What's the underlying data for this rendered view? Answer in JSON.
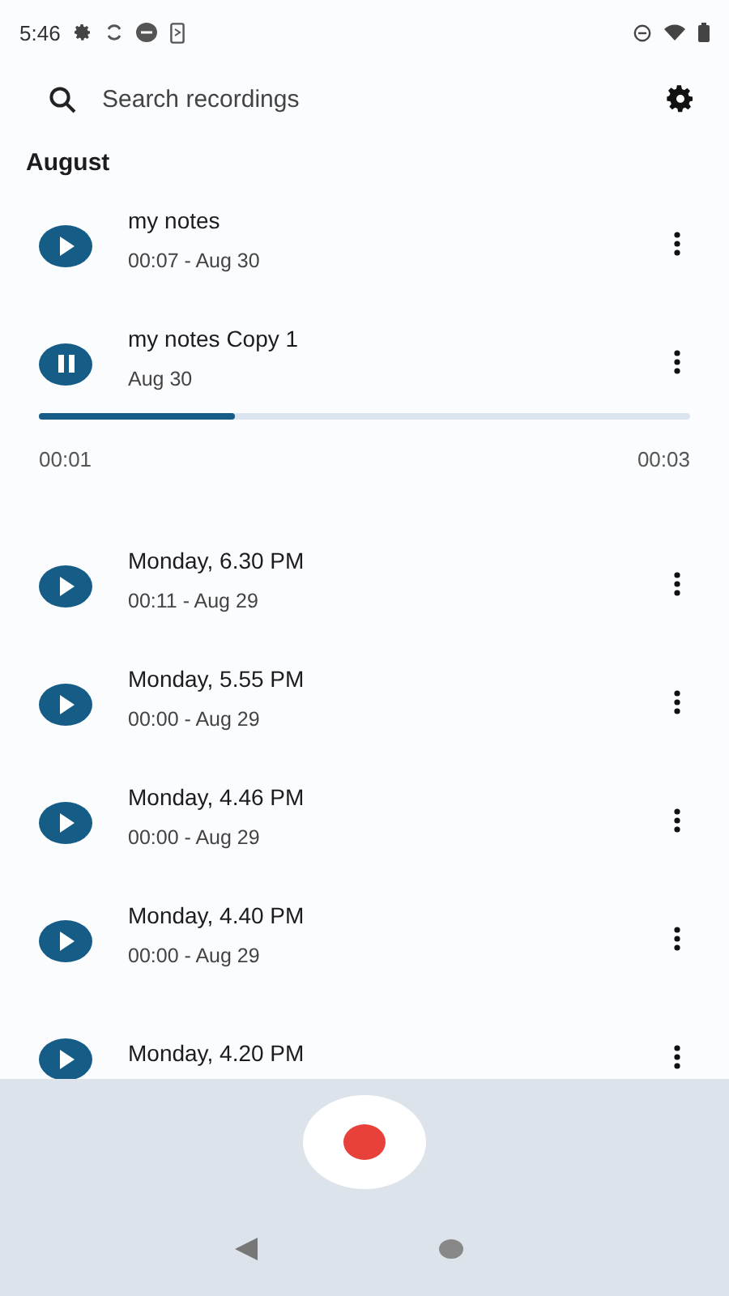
{
  "status_bar": {
    "time": "5:46"
  },
  "search": {
    "placeholder": "Search recordings"
  },
  "section": "August",
  "recordings": [
    {
      "title": "my notes",
      "subtitle": "00:07 - Aug 30",
      "playing": false
    },
    {
      "title": "my notes Copy 1",
      "subtitle": "Aug 30",
      "playing": true,
      "level": 0.3,
      "elapsed": "00:01",
      "total": "00:03"
    },
    {
      "title": "Monday, 6.30 PM",
      "subtitle": "00:11 - Aug 29",
      "playing": false
    },
    {
      "title": "Monday, 5.55 PM",
      "subtitle": "00:00 - Aug 29",
      "playing": false
    },
    {
      "title": "Monday, 4.46 PM",
      "subtitle": "00:00 - Aug 29",
      "playing": false
    },
    {
      "title": "Monday, 4.40 PM",
      "subtitle": "00:00 - Aug 29",
      "playing": false
    },
    {
      "title": "Monday, 4.20 PM",
      "playing": false
    }
  ]
}
